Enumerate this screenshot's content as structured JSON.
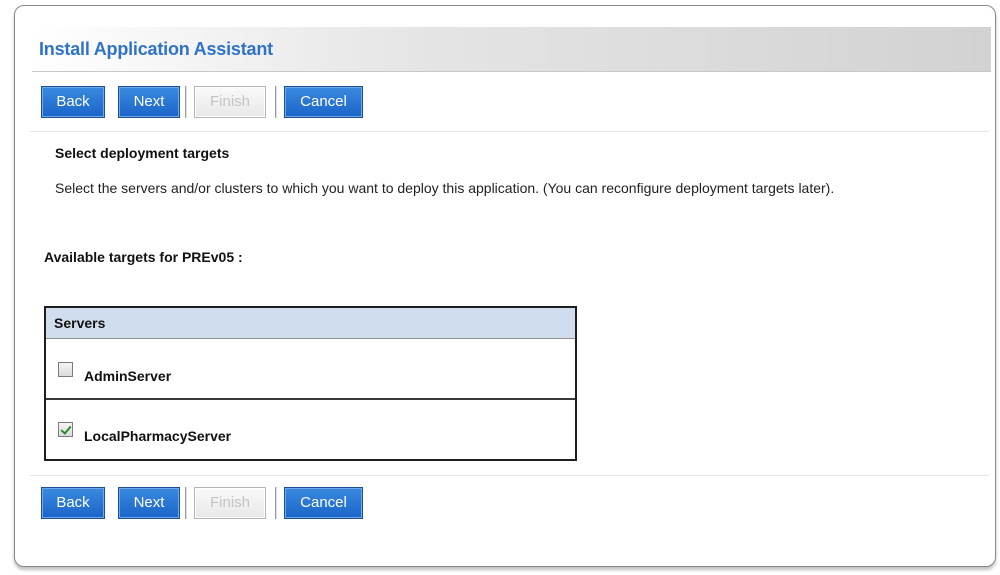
{
  "assistant": {
    "title": "Install Application Assistant"
  },
  "buttons": {
    "back": "Back",
    "next": "Next",
    "finish": "Finish",
    "cancel": "Cancel"
  },
  "content": {
    "section_title": "Select deployment targets",
    "description": "Select the servers and/or clusters to which you want to deploy this application. (You can reconfigure deployment targets later).",
    "available_targets_label": "Available targets for PREv05 :"
  },
  "servers_table": {
    "header": "Servers",
    "rows": [
      {
        "name": "AdminServer",
        "checked": false
      },
      {
        "name": "LocalPharmacyServer",
        "checked": true
      }
    ]
  },
  "colors": {
    "title": "#2f73c9",
    "button_primary": "#1a64c8",
    "table_header": "#d0ddee",
    "check": "#2a8a2a"
  }
}
